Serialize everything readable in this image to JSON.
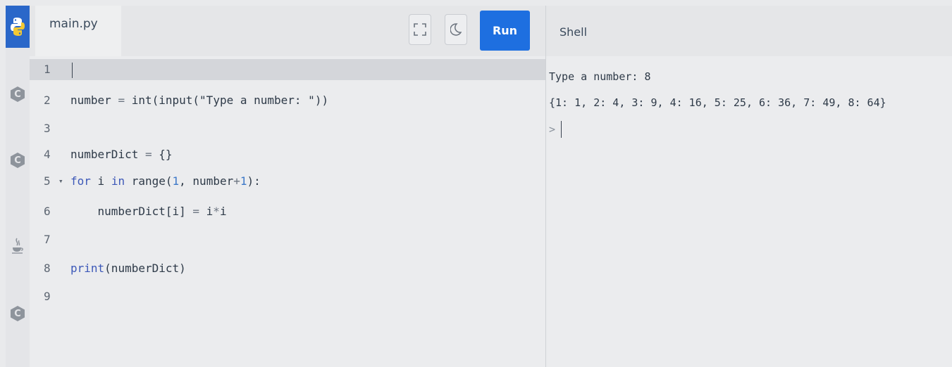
{
  "sidebar": {
    "items": [
      {
        "name": "python-logo-icon",
        "active": true
      },
      {
        "name": "c-logo-icon",
        "glyph": "C"
      },
      {
        "name": "cpp-logo-icon",
        "glyph": "C"
      },
      {
        "name": "java-logo-icon"
      },
      {
        "name": "csharp-logo-icon",
        "glyph": "C"
      }
    ]
  },
  "toolbar": {
    "file_tab": "main.py",
    "fullscreen_icon": "fullscreen-icon",
    "theme_icon": "moon-icon",
    "run_label": "Run",
    "shell_label": "Shell"
  },
  "editor": {
    "lines": [
      {
        "n": "1",
        "text": ""
      },
      {
        "n": "2",
        "text": "number = int(input(\"Type a number: \"))"
      },
      {
        "n": "3",
        "text": ""
      },
      {
        "n": "4",
        "text": "numberDict = {}"
      },
      {
        "n": "5",
        "text": "for i in range(1, number+1):"
      },
      {
        "n": "6",
        "text": "    numberDict[i] = i*i"
      },
      {
        "n": "7",
        "text": ""
      },
      {
        "n": "8",
        "text": "print(numberDict)"
      },
      {
        "n": "9",
        "text": ""
      }
    ]
  },
  "shell": {
    "output": [
      "Type a number: 8",
      "{1: 1, 2: 4, 3: 9, 4: 16, 5: 25, 6: 36, 7: 49, 8: 64}"
    ],
    "prompt": ">"
  },
  "colors": {
    "accent": "#1e6fe0",
    "keyword": "#3c58b8",
    "number": "#3c78c8"
  }
}
